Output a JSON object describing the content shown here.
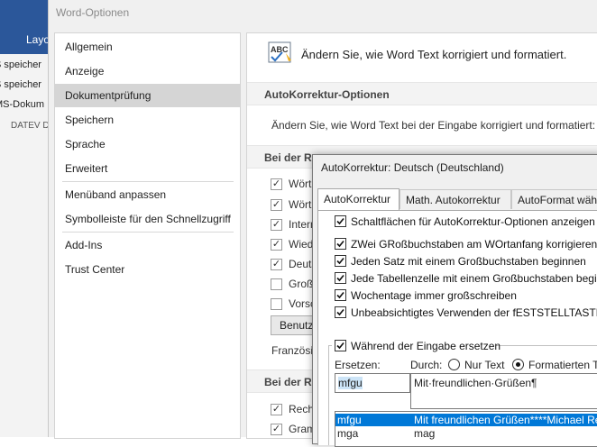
{
  "background_app": {
    "ribbon_tab": "Layo",
    "lines": [
      "S speicher",
      "S speicher",
      "MS-Dokum"
    ],
    "footer": "DATEV D"
  },
  "options_dialog": {
    "title": "Word-Optionen",
    "nav": [
      "Allgemein",
      "Anzeige",
      "Dokumentprüfung",
      "Speichern",
      "Sprache",
      "Erweitert",
      "Menüband anpassen",
      "Symbolleiste für den Schnellzugriff",
      "Add-Ins",
      "Trust Center"
    ],
    "active_nav": "Dokumentprüfung",
    "header_text": "Ändern Sie, wie Word Text korrigiert und formatiert.",
    "autocorrect_section": "AutoKorrektur-Optionen",
    "autocorrect_desc": "Ändern Sie, wie Word Text bei der Eingabe korrigiert und formatiert:",
    "spelling_section": "Bei der Re",
    "spelling_options": [
      {
        "label": "Wört",
        "checked": true
      },
      {
        "label": "Wört",
        "checked": true
      },
      {
        "label": "Intern",
        "checked": true
      },
      {
        "label": "Wied",
        "checked": true
      },
      {
        "label": "Deuts",
        "checked": true
      },
      {
        "label": "Großb",
        "checked": false
      },
      {
        "label": "Vorsc",
        "checked": false
      }
    ],
    "benutz_button": "Benutz",
    "franz_label": "Französis",
    "grammar_section": "Bei der Re",
    "grammar_options": [
      {
        "label": "Recht",
        "checked": true
      },
      {
        "label": "Gram",
        "checked": true
      }
    ]
  },
  "autokorrektur_dialog": {
    "title": "AutoKorrektur: Deutsch (Deutschland)",
    "tabs": [
      "AutoKorrektur",
      "Math. Autokorrektur",
      "AutoFormat wäh"
    ],
    "active_tab": "AutoKorrektur",
    "options": [
      {
        "label": "Schaltflächen für AutoKorrektur-Optionen anzeigen",
        "checked": true
      },
      {
        "label": "ZWei GRoßbuchstaben am WOrtanfang korrigieren",
        "checked": true
      },
      {
        "label": "Jeden Satz mit einem Großbuchstaben beginnen",
        "checked": true
      },
      {
        "label": "Jede Tabellenzelle mit einem Großbuchstaben beginn",
        "checked": true
      },
      {
        "label": "Wochentage immer großschreiben",
        "checked": true
      },
      {
        "label": "Unbeabsichtigtes Verwenden der fESTSTELLTASTE kor",
        "checked": true
      }
    ],
    "replace_while_typing": {
      "label": "Während der Eingabe ersetzen",
      "checked": true
    },
    "ersetzen_label": "Ersetzen:",
    "durch_label": "Durch:",
    "radio_plain": "Nur Text",
    "radio_formatted": "Formatierten Te",
    "selected_radio": "formatted",
    "ersetzen_value": "mfgu",
    "durch_value": "Mit·freundlichen·Grüßen¶",
    "list": [
      {
        "key": "mfgu",
        "value": "Mit freundlichen Grüßen****Michael Re"
      },
      {
        "key": "mga",
        "value": "mag"
      }
    ],
    "selected_list_row": 0
  }
}
